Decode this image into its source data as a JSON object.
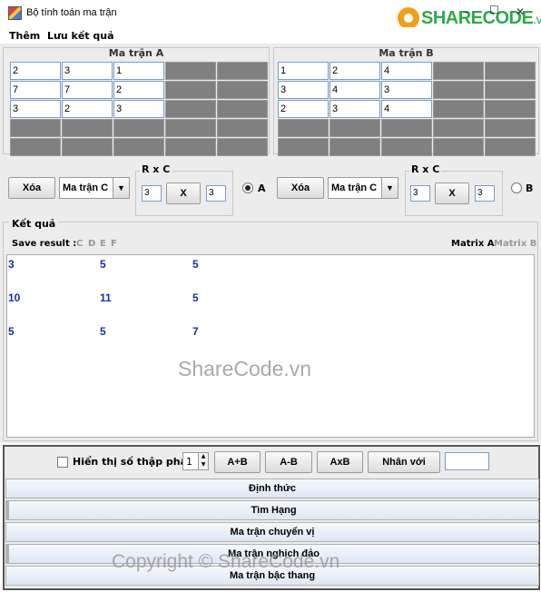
{
  "window": {
    "title": "Bộ tính toán ma trận",
    "minimize": "–",
    "maximize": "☐",
    "close": "✕"
  },
  "watermark": {
    "logo_text": "SHARECODE",
    "logo_suffix": ".vn",
    "center": "ShareCode.vn",
    "footer": "Copyright © ShareCode.vn"
  },
  "menu": {
    "items": [
      "Thêm",
      "Lưu kết quả"
    ]
  },
  "matrixA": {
    "title": "Ma trận A",
    "rows": [
      [
        "2",
        "3",
        "1"
      ],
      [
        "7",
        "7",
        "2"
      ],
      [
        "3",
        "2",
        "3"
      ]
    ]
  },
  "matrixB": {
    "title": "Ma trận B",
    "rows": [
      [
        "1",
        "2",
        "4"
      ],
      [
        "3",
        "4",
        "3"
      ],
      [
        "2",
        "3",
        "4"
      ]
    ]
  },
  "controlsA": {
    "clear_label": "Xóa",
    "target": "Ma trận C",
    "rc_title": "R x C",
    "rows": "3",
    "cols": "3",
    "x_label": "X",
    "radio_label": "A",
    "radio_selected": true
  },
  "controlsB": {
    "clear_label": "Xóa",
    "target": "Ma trận C",
    "rc_title": "R x C",
    "rows": "3",
    "cols": "3",
    "x_label": "X",
    "radio_label": "B",
    "radio_selected": false
  },
  "result": {
    "title": "Kết quả",
    "save_label": "Save result :",
    "save_options": [
      "C",
      "D",
      "E",
      "F"
    ],
    "matrix_labels": [
      "Matrix A",
      "Matrix B"
    ],
    "rows": [
      [
        "3",
        "5",
        "5"
      ],
      [
        "10",
        "11",
        "5"
      ],
      [
        "5",
        "5",
        "7"
      ]
    ]
  },
  "options": {
    "decimal_label": "Hiển thị số thập phân",
    "decimal_checked": false,
    "spinner_value": "1",
    "buttons": [
      "A+B",
      "A-B",
      "AxB",
      "Nhân với"
    ],
    "multiplier": ""
  },
  "functions": [
    "Định thức",
    "Tìm Hạng",
    "Ma trận chuyển vị",
    "Ma trận nghịch đảo",
    "Ma trận bậc thang"
  ],
  "colors": {
    "result_text": "#1a2fa8",
    "disabled_cell": "#808080",
    "logo": "#2eaa4f"
  }
}
